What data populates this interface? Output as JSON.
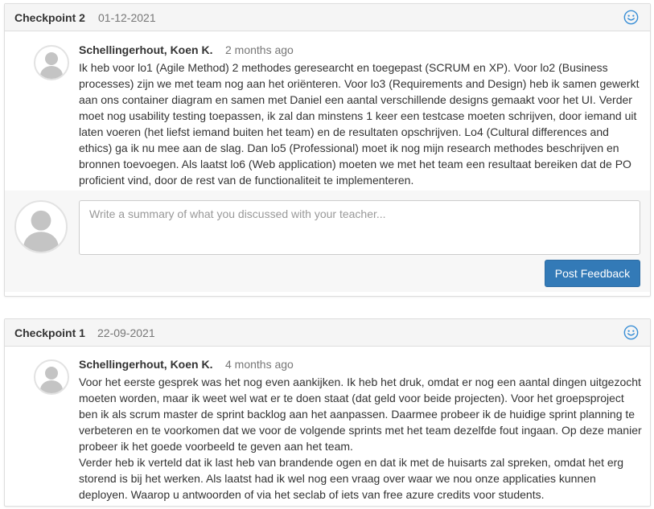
{
  "checkpoints": [
    {
      "title": "Checkpoint 2",
      "date": "01-12-2021",
      "comment": {
        "author": "Schellingerhout, Koen K.",
        "time_ago": "2 months ago",
        "lines": [
          "Ik heb voor lo1 (Agile Method) 2 methodes geresearcht en toegepast (SCRUM en XP). Voor lo2 (Business",
          "processes) zijn we met team nog aan het oriënteren. Voor lo3 (Requirements and Design) heb ik samen gewerkt",
          "aan ons container diagram en samen met Daniel een aantal verschillende designs gemaakt voor het UI. Verder",
          "moet nog usability testing toepassen, ik zal dan minstens 1 keer een testcase moeten schrijven, door iemand uit",
          "laten voeren (het liefst iemand buiten het team) en de resultaten opschrijven. Lo4 (Cultural differences and",
          "ethics) ga ik nu mee aan de slag. Dan lo5 (Professional) moet ik nog mijn research methodes beschrijven en",
          "bronnen toevoegen. Als laatst lo6 (Web application) moeten we met het team een resultaat bereiken dat de PO",
          "proficient vind, door de rest van de functionaliteit te implementeren."
        ]
      },
      "reply": {
        "placeholder": "Write a summary of what you discussed with your teacher...",
        "button_label": "Post Feedback"
      }
    },
    {
      "title": "Checkpoint 1",
      "date": "22-09-2021",
      "comment": {
        "author": "Schellingerhout, Koen K.",
        "time_ago": "4 months ago",
        "lines": [
          "Voor het eerste gesprek was het nog even aankijken. Ik heb het druk, omdat er nog een aantal dingen uitgezocht",
          "moeten worden, maar ik weet wel wat er te doen staat (dat geld voor beide projecten). Voor het groepsproject",
          "ben ik als scrum master de sprint backlog aan het aanpassen. Daarmee probeer ik de huidige sprint planning te",
          "verbeteren en te voorkomen dat we voor de volgende sprints met het team dezelfde fout ingaan. Op deze manier",
          "probeer ik het goede voorbeeld te geven aan het team.",
          "Verder heb ik verteld dat ik last heb van brandende ogen en dat ik met de huisarts zal spreken, omdat het erg",
          "storend is bij het werken. Als laatst had ik wel nog een vraag over waar we nou onze applicaties kunnen",
          "deployen. Waarop u antwoorden of via het seclab of iets van free azure credits voor students."
        ]
      }
    }
  ],
  "icons": {
    "mood": "smiley-icon",
    "avatar": "default-user-avatar-icon"
  },
  "colors": {
    "accent": "#337ab7",
    "icon": "#3a8fd6"
  }
}
